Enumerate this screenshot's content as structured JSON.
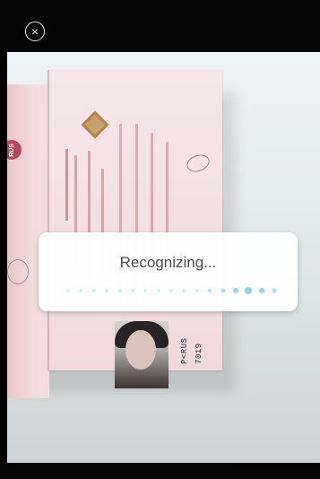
{
  "top_bar": {
    "close_icon": "close-icon"
  },
  "document": {
    "country_badge": "RUS",
    "mrz_lines": [
      "P<RUS",
      "7019"
    ]
  },
  "dialog": {
    "title": "Recognizing...",
    "progress_dots": {
      "count": 17,
      "active_index": 14,
      "color": "#8fd3e8"
    }
  },
  "colors": {
    "bar": "#050505",
    "dialog_text": "#4a4a4a",
    "accent_dots": "#8fd3e8"
  }
}
